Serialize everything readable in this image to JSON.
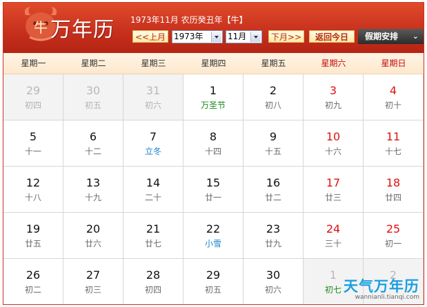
{
  "header": {
    "logo_text": "万年历",
    "logo_ox_char": "牛",
    "title": "1973年11月 农历癸丑年【牛】",
    "prev_month": "<<上月",
    "year_value": "1973年",
    "month_value": "11月",
    "next_month": "下月>>",
    "today": "返回今日",
    "holiday": "假期安排",
    "holiday_chevron": "⌄"
  },
  "weekdays": [
    "星期一",
    "星期二",
    "星期三",
    "星期四",
    "星期五",
    "星期六",
    "星期日"
  ],
  "days": [
    {
      "day": "29",
      "lunar": "初四",
      "other": true
    },
    {
      "day": "30",
      "lunar": "初五",
      "other": true
    },
    {
      "day": "31",
      "lunar": "初六",
      "other": true
    },
    {
      "day": "1",
      "lunar": "万圣节",
      "kind": "festival"
    },
    {
      "day": "2",
      "lunar": "初八"
    },
    {
      "day": "3",
      "lunar": "初九"
    },
    {
      "day": "4",
      "lunar": "初十"
    },
    {
      "day": "5",
      "lunar": "十一"
    },
    {
      "day": "6",
      "lunar": "十二"
    },
    {
      "day": "7",
      "lunar": "立冬",
      "kind": "term"
    },
    {
      "day": "8",
      "lunar": "十四"
    },
    {
      "day": "9",
      "lunar": "十五"
    },
    {
      "day": "10",
      "lunar": "十六"
    },
    {
      "day": "11",
      "lunar": "十七"
    },
    {
      "day": "12",
      "lunar": "十八"
    },
    {
      "day": "13",
      "lunar": "十九"
    },
    {
      "day": "14",
      "lunar": "二十"
    },
    {
      "day": "15",
      "lunar": "廿一"
    },
    {
      "day": "16",
      "lunar": "廿二"
    },
    {
      "day": "17",
      "lunar": "廿三"
    },
    {
      "day": "18",
      "lunar": "廿四"
    },
    {
      "day": "19",
      "lunar": "廿五"
    },
    {
      "day": "20",
      "lunar": "廿六"
    },
    {
      "day": "21",
      "lunar": "廿七"
    },
    {
      "day": "22",
      "lunar": "小雪",
      "kind": "term"
    },
    {
      "day": "23",
      "lunar": "廿九"
    },
    {
      "day": "24",
      "lunar": "三十"
    },
    {
      "day": "25",
      "lunar": "初一"
    },
    {
      "day": "26",
      "lunar": "初二"
    },
    {
      "day": "27",
      "lunar": "初三"
    },
    {
      "day": "28",
      "lunar": "初四"
    },
    {
      "day": "29",
      "lunar": "初五"
    },
    {
      "day": "30",
      "lunar": "初六"
    },
    {
      "day": "1",
      "lunar": "初七",
      "other": true,
      "kind": "festival"
    },
    {
      "day": "2",
      "lunar": "",
      "other": true
    }
  ],
  "watermark": {
    "main": "天气万年历",
    "sub": "wannianli.tianqi.com"
  },
  "colors": {
    "header_red": "#c62f1c",
    "weekend_red": "#e01010",
    "festival_green": "#1b8a1b",
    "solar_term_blue": "#1a7fc8",
    "watermark_blue": "#1aa0e2"
  }
}
